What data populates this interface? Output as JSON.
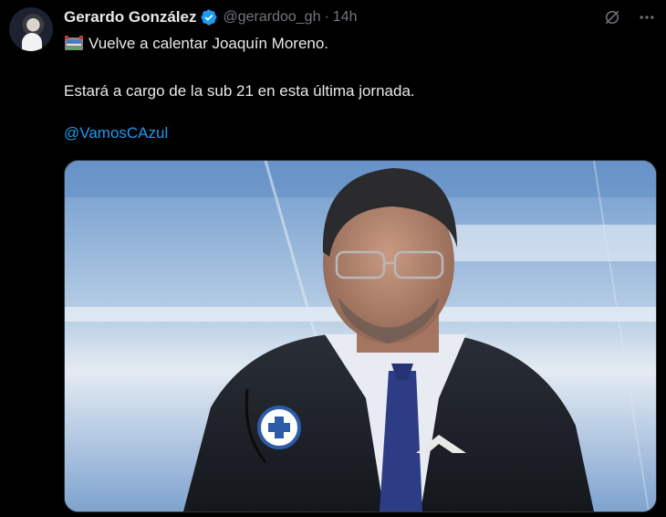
{
  "author": {
    "name": "Gerardo González",
    "handle": "@gerardoo_gh",
    "separator": "·",
    "time": "14h",
    "verified": true
  },
  "icons": {
    "verified": "verified-badge-icon",
    "grok": "grok-icon",
    "more": "more-options-icon",
    "emoji": "stadium-emoji-icon"
  },
  "tweet": {
    "line1": "Vuelve a calentar Joaquín Moreno.",
    "line2": "Estará a cargo de la sub 21 en esta última jornada.",
    "mention": "@VamosCAzul"
  },
  "colors": {
    "background": "#000000",
    "text": "#e7e9ea",
    "muted": "#71767b",
    "link": "#1d9bf0",
    "verified": "#1d9bf0"
  }
}
